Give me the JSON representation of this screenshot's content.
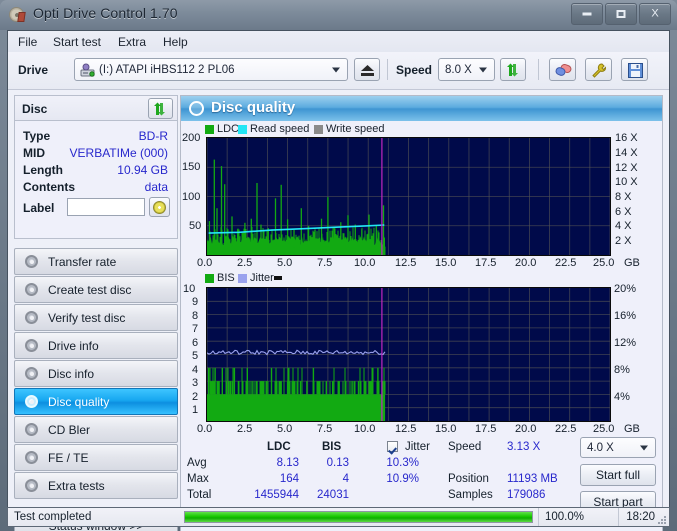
{
  "window": {
    "title": "Opti Drive Control 1.70",
    "icon": "disc-icon",
    "minimize": "minimize-icon",
    "maximize": "maximize-icon",
    "close": "X"
  },
  "menu": {
    "items": [
      "File",
      "Start test",
      "Extra",
      "Help"
    ]
  },
  "toolbar": {
    "drive_label": "Drive",
    "drive_value": "(I:)  ATAPI iHBS112  2 PL06",
    "eject_icon": "eject-icon",
    "speed_label": "Speed",
    "speed_value": "8.0 X",
    "refresh_icon": "refresh-icon",
    "erase_icon": "erase-icon",
    "tools_icon": "tools-icon",
    "save_icon": "save-icon"
  },
  "sidebar": {
    "disc_header": "Disc",
    "disc_refresh_icon": "refresh-icon",
    "disc_fields": [
      {
        "key": "Type",
        "value": "BD-R"
      },
      {
        "key": "MID",
        "value": "VERBATIMe (000)"
      },
      {
        "key": "Length",
        "value": "10.94 GB"
      },
      {
        "key": "Contents",
        "value": "data"
      }
    ],
    "label_key": "Label",
    "label_value": "",
    "label_placeholder": "",
    "label_icon": "disc-label-icon",
    "nav_items": [
      {
        "label": "Transfer rate",
        "selected": false
      },
      {
        "label": "Create test disc",
        "selected": false
      },
      {
        "label": "Verify test disc",
        "selected": false
      },
      {
        "label": "Drive info",
        "selected": false
      },
      {
        "label": "Disc info",
        "selected": false
      },
      {
        "label": "Disc quality",
        "selected": true
      },
      {
        "label": "CD Bler",
        "selected": false
      },
      {
        "label": "FE / TE",
        "selected": false
      },
      {
        "label": "Extra tests",
        "selected": false
      }
    ],
    "status_window_button": "Status window >>"
  },
  "panel": {
    "title": "Disc quality",
    "icon": "disc-quality-icon"
  },
  "chart_data": [
    {
      "type": "line",
      "name": "top-chart-ldc",
      "title": "Disc quality",
      "xlabel": "GB",
      "ylabel": "LDC",
      "legend": [
        {
          "label": "LDC",
          "color": "#12aa12"
        },
        {
          "label": "Read speed",
          "color": "#22e6f5"
        },
        {
          "label": "Write speed",
          "color": "#8a8a8a"
        }
      ],
      "legend_position": "top-left",
      "grid": true,
      "xlim": [
        0,
        25.0
      ],
      "xticks": [
        0.0,
        2.5,
        5.0,
        7.5,
        10.0,
        12.5,
        15.0,
        17.5,
        20.0,
        22.5,
        25.0
      ],
      "xtick_labels": [
        "0.0",
        "2.5",
        "5.0",
        "7.5",
        "10.0",
        "12.5",
        "15.0",
        "17.5",
        "20.0",
        "22.5",
        "25.0"
      ],
      "ylim": [
        0,
        200
      ],
      "yticks": [
        50,
        100,
        150,
        200
      ],
      "ytick_labels": [
        "50",
        "100",
        "150",
        "200"
      ],
      "y2lim": [
        0,
        16
      ],
      "y2ticks": [
        2,
        4,
        6,
        8,
        10,
        12,
        14,
        16
      ],
      "y2tick_labels": [
        "2 X",
        "4 X",
        "6 X",
        "8 X",
        "10 X",
        "12 X",
        "14 X",
        "16 X"
      ],
      "data_extent_gb": 11.05,
      "marker_line_gb": 10.85,
      "marker_color": "#c026c0",
      "series": [
        {
          "name": "LDC",
          "color": "#12aa12",
          "baseline": 22,
          "peaks_gb_value": [
            [
              0.15,
              58
            ],
            [
              0.45,
              163
            ],
            [
              0.62,
              80
            ],
            [
              0.9,
              152
            ],
            [
              1.1,
              121
            ],
            [
              1.55,
              66
            ],
            [
              1.9,
              44
            ],
            [
              2.35,
              55
            ],
            [
              2.75,
              62
            ],
            [
              3.1,
              123
            ],
            [
              3.35,
              52
            ],
            [
              3.8,
              46
            ],
            [
              4.25,
              97
            ],
            [
              4.6,
              120
            ],
            [
              5.0,
              61
            ],
            [
              5.4,
              43
            ],
            [
              5.85,
              80
            ],
            [
              6.3,
              50
            ],
            [
              6.7,
              44
            ],
            [
              7.1,
              62
            ],
            [
              7.5,
              99
            ],
            [
              7.9,
              46
            ],
            [
              8.3,
              56
            ],
            [
              8.75,
              68
            ],
            [
              9.2,
              52
            ],
            [
              9.6,
              44
            ],
            [
              10.05,
              69
            ],
            [
              10.5,
              51
            ],
            [
              10.95,
              85
            ]
          ]
        },
        {
          "name": "Read speed",
          "color": "#22e6f5",
          "points_gb_x": [
            [
              0.1,
              3.0
            ],
            [
              2.0,
              3.1
            ],
            [
              4.0,
              3.4
            ],
            [
              6.0,
              3.6
            ],
            [
              8.0,
              3.8
            ],
            [
              10.0,
              4.0
            ],
            [
              11.0,
              4.1
            ]
          ]
        }
      ]
    },
    {
      "type": "line",
      "name": "bottom-chart-bis",
      "xlabel": "GB",
      "ylabel": "BIS",
      "legend": [
        {
          "label": "BIS",
          "color": "#12aa12"
        },
        {
          "label": "Jitter",
          "color": "#9aa2ee"
        }
      ],
      "legend_position": "top-left",
      "grid": true,
      "xlim": [
        0,
        25.0
      ],
      "xticks": [
        0.0,
        2.5,
        5.0,
        7.5,
        10.0,
        12.5,
        15.0,
        17.5,
        20.0,
        22.5,
        25.0
      ],
      "xtick_labels": [
        "0.0",
        "2.5",
        "5.0",
        "7.5",
        "10.0",
        "12.5",
        "15.0",
        "17.5",
        "20.0",
        "22.5",
        "25.0"
      ],
      "ylim": [
        0,
        10
      ],
      "yticks": [
        1,
        2,
        3,
        4,
        5,
        6,
        7,
        8,
        9,
        10
      ],
      "ytick_labels": [
        "1",
        "2",
        "3",
        "4",
        "5",
        "6",
        "7",
        "8",
        "9",
        "10"
      ],
      "y2lim": [
        0,
        20
      ],
      "y2ticks": [
        4,
        8,
        12,
        16,
        20
      ],
      "y2tick_labels": [
        "4%",
        "8%",
        "12%",
        "16%",
        "20%"
      ],
      "data_extent_gb": 11.05,
      "marker_line_gb": 10.85,
      "marker_color": "#c026c0",
      "series": [
        {
          "name": "BIS",
          "color": "#12aa12",
          "fill_level": 2.0,
          "spikes_gb_value": [
            [
              0.1,
              4
            ],
            [
              0.3,
              3
            ],
            [
              0.5,
              4
            ],
            [
              0.75,
              3
            ],
            [
              0.95,
              4
            ],
            [
              1.2,
              3
            ],
            [
              1.45,
              3
            ],
            [
              1.7,
              4
            ],
            [
              1.95,
              3
            ],
            [
              2.2,
              3
            ],
            [
              2.5,
              4
            ],
            [
              2.8,
              3
            ],
            [
              3.1,
              3
            ],
            [
              3.4,
              3
            ],
            [
              3.7,
              3
            ],
            [
              4.0,
              4
            ],
            [
              4.3,
              3
            ],
            [
              4.6,
              3
            ],
            [
              5.0,
              3
            ],
            [
              5.4,
              3
            ],
            [
              5.8,
              3
            ],
            [
              6.2,
              3
            ],
            [
              6.6,
              4
            ],
            [
              7.0,
              3
            ],
            [
              7.4,
              3
            ],
            [
              7.8,
              3
            ],
            [
              8.2,
              3
            ],
            [
              8.6,
              3
            ],
            [
              9.0,
              3
            ],
            [
              9.4,
              3
            ],
            [
              9.8,
              3
            ],
            [
              10.2,
              3
            ],
            [
              10.6,
              4
            ],
            [
              10.9,
              3
            ]
          ]
        },
        {
          "name": "Jitter",
          "color": "#9aa2ee",
          "avg_value": 5.15,
          "percent_axis_value": 10.3
        }
      ]
    }
  ],
  "stats": {
    "col_headers": [
      "",
      "LDC",
      "BIS"
    ],
    "rows": [
      {
        "label": "Avg",
        "ldc": "8.13",
        "bis": "0.13",
        "jitter": "10.3%"
      },
      {
        "label": "Max",
        "ldc": "164",
        "bis": "4",
        "jitter": "10.9%"
      },
      {
        "label": "Total",
        "ldc": "1455944",
        "bis": "24031",
        "jitter": ""
      }
    ],
    "jitter_checkbox_checked": true,
    "jitter_label": "Jitter",
    "speed_label": "Speed",
    "speed_value": "3.13 X",
    "position_label": "Position",
    "position_value": "11193 MB",
    "samples_label": "Samples",
    "samples_value": "179086",
    "speed_select_value": "4.0 X",
    "start_full_button": "Start full",
    "start_part_button": "Start part"
  },
  "statusbar": {
    "message": "Test completed",
    "progress_percent": "100.0%",
    "progress_value": 100,
    "time": "18:20"
  },
  "colors": {
    "accent": "#3e95d2",
    "value_text": "#2828cc",
    "chart_bg": "#000a4a",
    "ldc_green": "#12aa12",
    "read_speed": "#22e6f5",
    "write_speed": "#8a8a8a",
    "jitter": "#9aa2ee",
    "marker": "#c026c0",
    "progress": "#18c800"
  }
}
